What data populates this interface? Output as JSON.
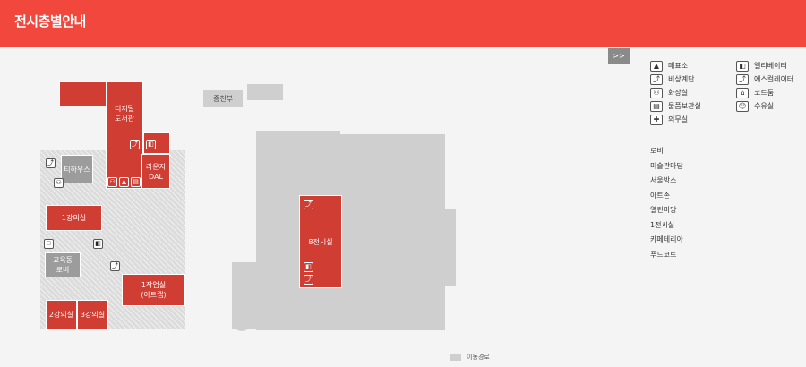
{
  "header": {
    "title": "전시층별안내"
  },
  "map": {
    "collapse_label": ">>",
    "rooms": {
      "digital_library": "디지털\n도서관",
      "lounge": "라운지\nDAL",
      "tea_house": "티하우스",
      "lecture1": "1강의실",
      "education": "교육동\n로비",
      "lecture2": "2강의실",
      "lecture3": "3강의실",
      "workshop": "1작업실\n(아트랩)",
      "exhibition8": "8전시실",
      "info": "종친부"
    },
    "route_label": "이동경로"
  },
  "legend": {
    "items": [
      {
        "icon": "shop-icon",
        "glyph": "▲",
        "label": "매표소"
      },
      {
        "icon": "elevator-icon",
        "glyph": "◧",
        "label": "엘리베이터"
      },
      {
        "icon": "emergency-stairs-icon",
        "glyph": "⤴",
        "label": "비상계단"
      },
      {
        "icon": "escalator-icon",
        "glyph": "⤴",
        "label": "에스컬레이터"
      },
      {
        "icon": "restroom-icon",
        "glyph": "⚇",
        "label": "화장실"
      },
      {
        "icon": "coat-room-icon",
        "glyph": "⌂",
        "label": "코트룸"
      },
      {
        "icon": "locker-icon",
        "glyph": "▤",
        "label": "물품보관실"
      },
      {
        "icon": "nursing-room-icon",
        "glyph": "☺",
        "label": "수유실"
      },
      {
        "icon": "first-aid-icon",
        "glyph": "✚",
        "label": "의무실"
      }
    ],
    "floors": [
      "로비",
      "미술관마당",
      "서울박스",
      "아트존",
      "열린마당",
      "1전시실",
      "카페테리아",
      "푸드코트"
    ]
  }
}
